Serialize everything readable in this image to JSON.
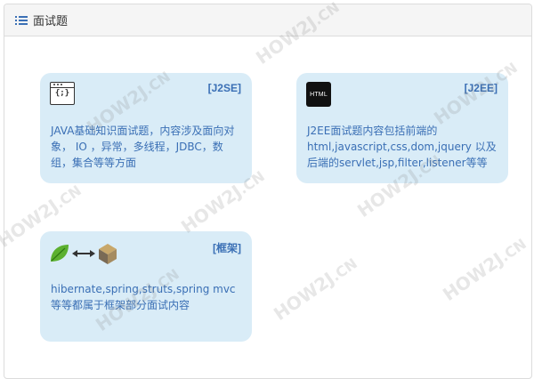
{
  "header": {
    "icon": "list-icon",
    "title": "面试题"
  },
  "cards": [
    {
      "icon": "code-window-icon",
      "icon_text": "{;}",
      "tag": "[J2SE]",
      "description": "JAVA基础知识面试题，内容涉及面向对象， IO ，异常，多线程，JDBC，数组，集合等等方面"
    },
    {
      "icon": "html-icon",
      "icon_text": "HTML",
      "tag": "[J2EE]",
      "description": "J2EE面试题内容包括前端的html,javascript,css,dom,jquery 以及后端的servlet,jsp,filter,listener等等"
    },
    {
      "icon": "hibernate-spring-struts-icons",
      "tag": "[框架]",
      "description": "hibernate,spring,struts,spring mvc 等等都属于框架部分面试内容"
    }
  ],
  "watermark": {
    "text": "HOW2J",
    "suffix": ".CN",
    "color": "#b4b4b4"
  },
  "colors": {
    "card_bg": "#d9ecf7",
    "accent": "#3a6fb5"
  }
}
